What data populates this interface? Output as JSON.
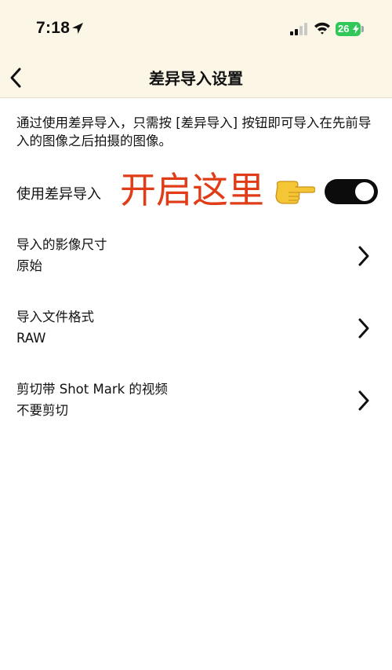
{
  "status_bar": {
    "time": "7:18",
    "battery_level": "26"
  },
  "nav": {
    "title": "差异导入设置",
    "back_icon": "chevron-left-icon"
  },
  "description": "通过使用差异导入，只需按 [差异导入] 按钮即可导入在先前导入的图像之后拍摄的图像。",
  "differential_import": {
    "label": "使用差异导入",
    "enabled": true,
    "annotation_text": "开启这里",
    "annotation_color": "#e03c18"
  },
  "settings": [
    {
      "label": "导入的影像尺寸",
      "value": "原始"
    },
    {
      "label": "导入文件格式",
      "value": "RAW"
    },
    {
      "label": "剪切带 Shot Mark 的视频",
      "value": "不要剪切"
    }
  ],
  "colors": {
    "header_bg": "#fbf6e6",
    "toggle_on": "#0c0c0c",
    "battery": "#31c759"
  }
}
